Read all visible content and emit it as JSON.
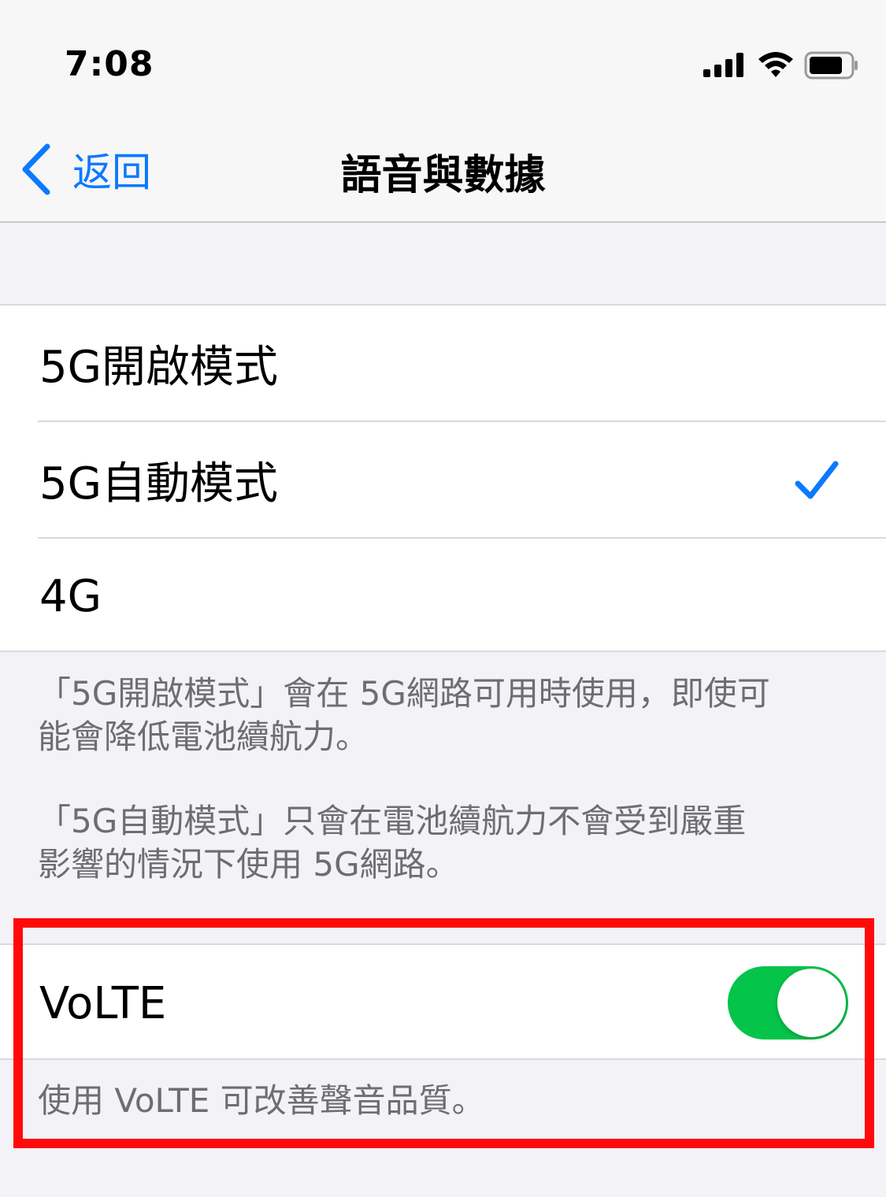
{
  "status_bar": {
    "time": "7:08"
  },
  "nav": {
    "back_label": "返回",
    "title": "語音與數據"
  },
  "network_options": [
    {
      "label": "5G開啟模式",
      "selected": false
    },
    {
      "label": "5G自動模式",
      "selected": true
    },
    {
      "label": "4G",
      "selected": false
    }
  ],
  "footer": {
    "line1": "「5G開啟模式」會在 5G網路可用時使用，即使可",
    "line2": "能會降低電池續航力。",
    "line3": "「5G自動模式」只會在電池續航力不會受到嚴重",
    "line4": "影響的情況下使用 5G網路。"
  },
  "volte": {
    "label": "VoLTE",
    "enabled": true,
    "footer": "使用 VoLTE 可改善聲音品質。"
  },
  "colors": {
    "accent": "#0a7aff",
    "toggle_on": "#05c44a",
    "highlight": "#ff0a0a"
  }
}
